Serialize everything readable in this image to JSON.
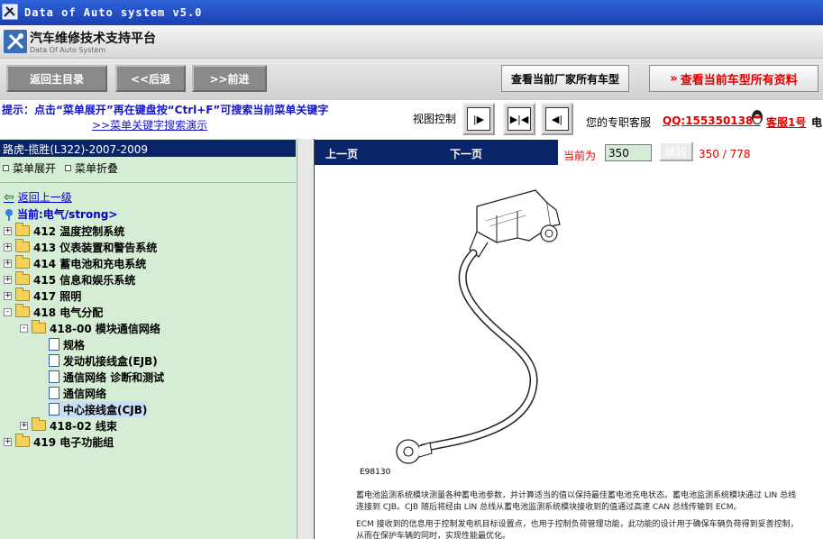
{
  "window": {
    "title": "Data of Auto system v5.0"
  },
  "brand": {
    "cn": "汽车维修技术支持平台",
    "en": "Data Of Auto System"
  },
  "toolbar": {
    "home": "返回主目录",
    "back": "<<后退",
    "forward": ">>前进",
    "all_models": "查看当前厂家所有车型",
    "all_data": "查看当前车型所有资料"
  },
  "hint": {
    "text": "提示：点击“菜单展开”再在键盘按“Ctrl+F”可搜索当前菜单关键字",
    "demo_link": ">>菜单关键字搜索演示",
    "view_label": "视图控制",
    "service_label": "您的专职客服",
    "qq": "QQ:1553501388",
    "cs": "客服1号",
    "cs_suffix": "电"
  },
  "left": {
    "header": "路虎-揽胜(L322)-2007-2009",
    "expand": "菜单展开",
    "collapse": "菜单折叠",
    "back_up": "返回上一级",
    "current": "当前:电气/strong>",
    "tree": [
      {
        "label": "412 温度控制系统",
        "pm": "+"
      },
      {
        "label": "413 仪表装置和警告系统",
        "pm": "+"
      },
      {
        "label": "414 蓄电池和充电系统",
        "pm": "+"
      },
      {
        "label": "415 信息和娱乐系统",
        "pm": "+"
      },
      {
        "label": "417 照明",
        "pm": "+"
      },
      {
        "label": "418 电气分配",
        "pm": "-"
      },
      {
        "label": "418-00 模块通信网络",
        "pm": "-"
      },
      {
        "label": "规格"
      },
      {
        "label": "发动机接线盒(EJB)"
      },
      {
        "label": "通信网络 诊断和测试"
      },
      {
        "label": "通信网络"
      },
      {
        "label": "中心接线盒(CJB)"
      },
      {
        "label": "418-02 线束",
        "pm": "+"
      },
      {
        "label": "419 电子功能组",
        "pm": "+"
      }
    ]
  },
  "right": {
    "prev": "上一页",
    "next": "下一页",
    "current_label": "当前为",
    "page_value": "350",
    "jump": "跳转",
    "page_count": "350 / 778",
    "figure_code": "E98130",
    "para1_line1": "蓄电池监测系统模块测量各种蓄电池参数，并计算适当的值以保持最佳蓄电池充电状态。蓄电池监测系统模块通过 LIN 总线",
    "para1_line2": "连接到 CJB。CJB 随后将经由 LIN 总线从蓄电池监测系统模块接收到的值通过高速 CAN 总线传输到 ECM。",
    "para2_line1": "ECM 接收到的信息用于控制发电机目标设置点，也用于控制负荷管理功能，此功能的设计用于确保车辆负荷得到妥善控制，",
    "para2_line2": "从而在保护车辆的同时，实现性能最优化。"
  },
  "colors": {
    "title_blue": "#1a3fb0",
    "nav_blue": "#0a246a",
    "tree_bg": "#d4edd4",
    "accent_red": "#e00000",
    "link_blue": "#1717c8"
  }
}
